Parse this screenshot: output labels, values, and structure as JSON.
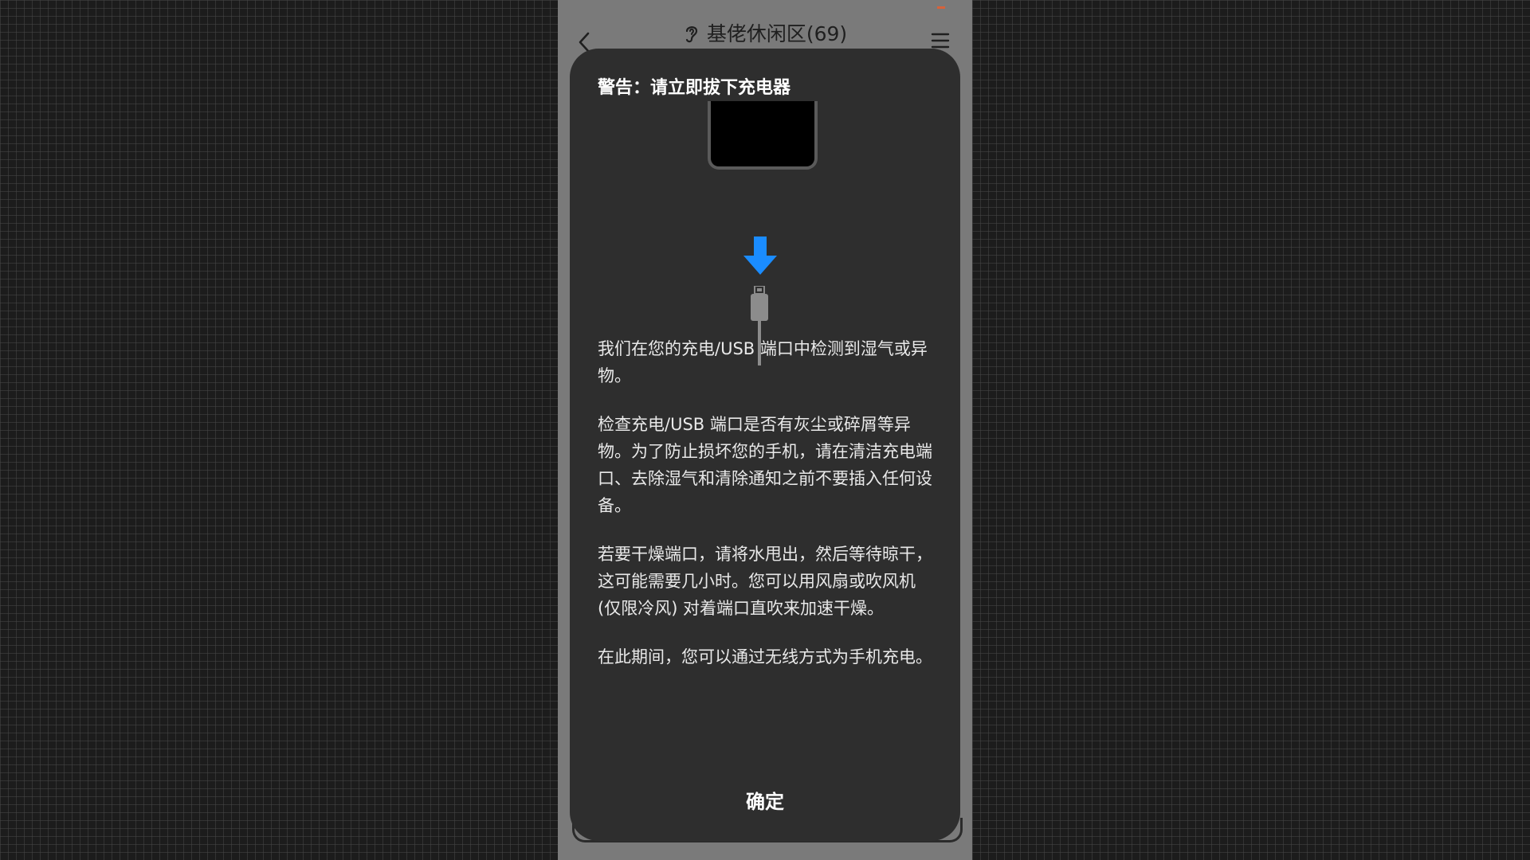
{
  "header": {
    "title": "基佬休闲区(69)",
    "icons": {
      "back": "back-chevron-icon",
      "ear": "ear-icon",
      "menu": "menu-icon"
    }
  },
  "dialog": {
    "title": "警告：请立即拔下充电器",
    "illustration_icons": [
      "phone-icon",
      "down-arrow-icon",
      "usb-plug-icon"
    ],
    "paragraphs": [
      "我们在您的充电/USB 端口中检测到湿气或异物。",
      "检查充电/USB 端口是否有灰尘或碎屑等异物。为了防止损坏您的手机，请在清洁充电端口、去除湿气和清除通知之前不要插入任何设备。",
      "若要干燥端口，请将水甩出，然后等待晾干，这可能需要几小时。您可以用风扇或吹风机 (仅限冷风) 对着端口直吹来加速干燥。",
      "在此期间，您可以通过无线方式为手机充电。"
    ],
    "confirm_label": "确定"
  },
  "colors": {
    "dialog_bg": "#2e2e2e",
    "arrow": "#1a8cff",
    "backdrop": "#7a7a7a"
  }
}
